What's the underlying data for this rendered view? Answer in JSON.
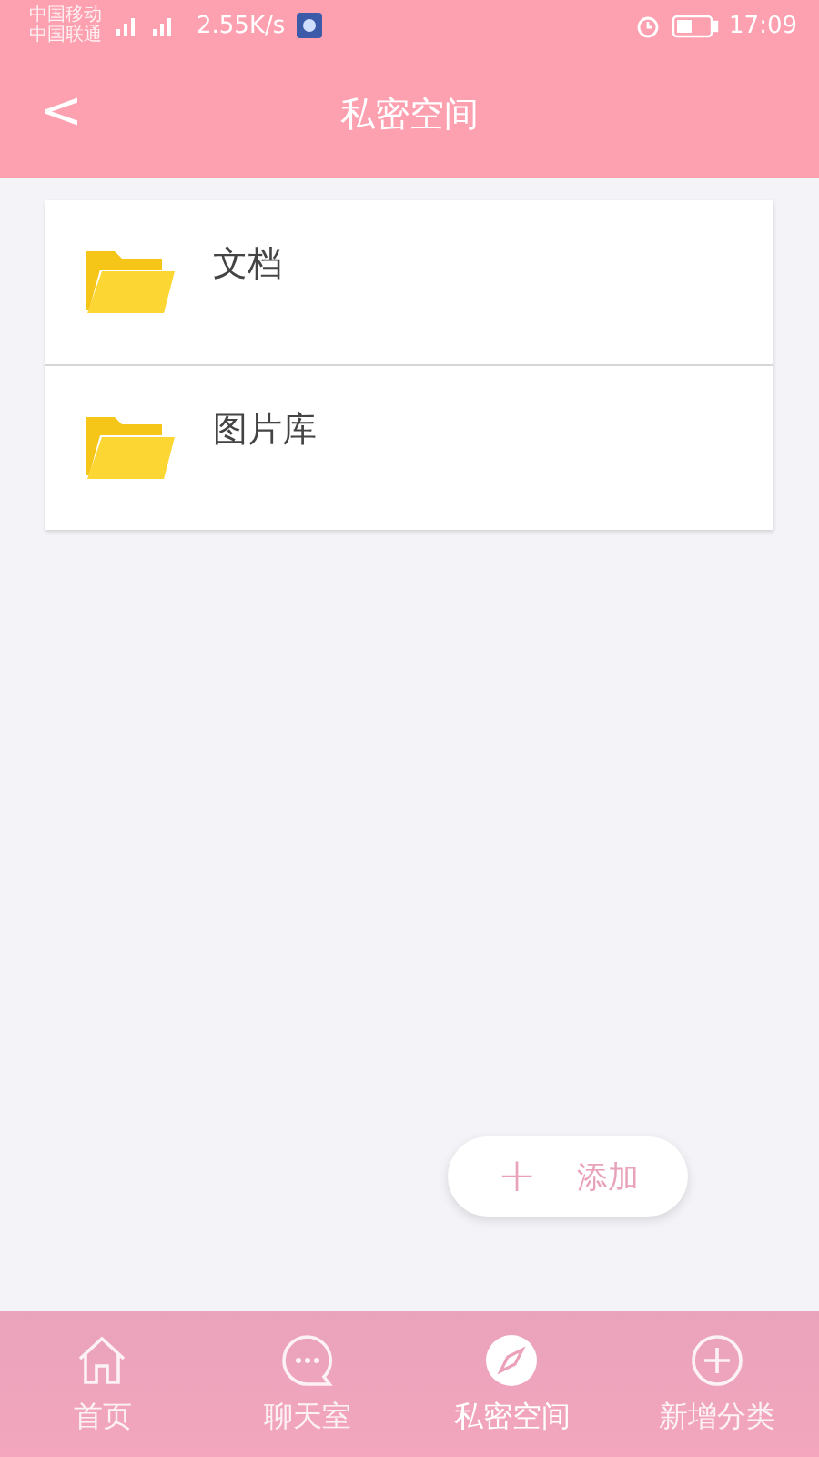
{
  "status_bar": {
    "carriers": [
      "中国移动",
      "中国联通"
    ],
    "speed": "2.55K/s",
    "time": "17:09"
  },
  "header": {
    "back": "<",
    "title": "私密空间"
  },
  "folders": [
    {
      "name": "文档"
    },
    {
      "name": "图片库"
    }
  ],
  "add_button": {
    "icon": "+",
    "label": "添加"
  },
  "tab_bar": [
    {
      "label": "首页",
      "kind": "home",
      "selected": false
    },
    {
      "label": "聊天室",
      "kind": "chat",
      "selected": false
    },
    {
      "label": "私密空间",
      "kind": "compass",
      "selected": true
    },
    {
      "label": "新增分类",
      "kind": "plus",
      "selected": false
    }
  ]
}
